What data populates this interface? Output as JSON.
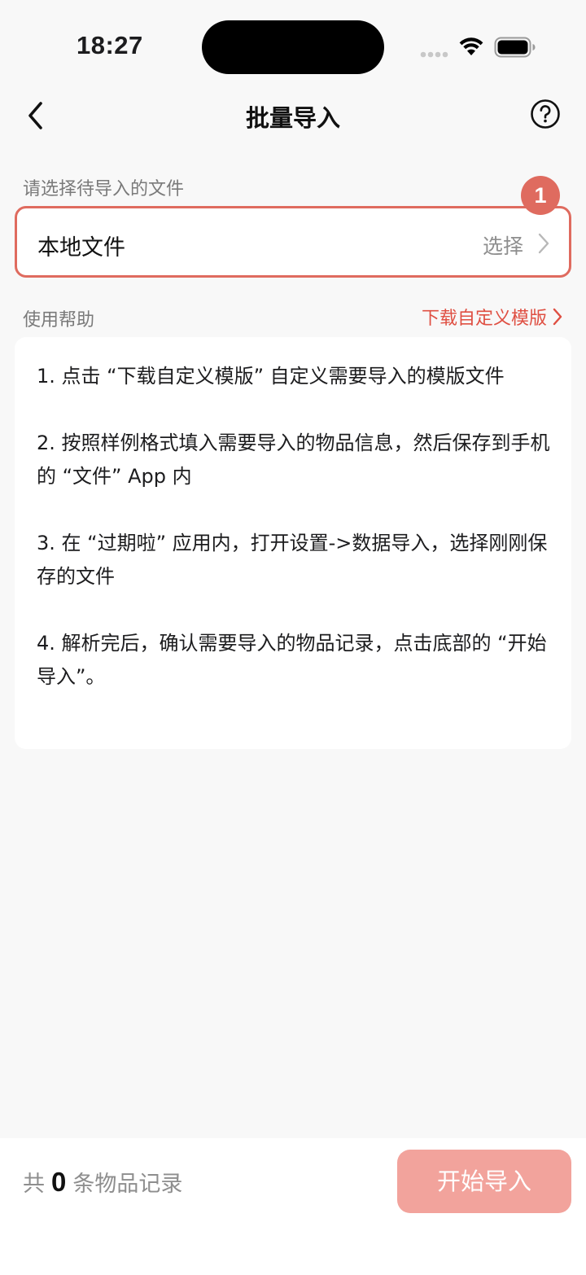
{
  "status_bar": {
    "time": "18:27"
  },
  "nav": {
    "title": "批量导入",
    "back_icon": "chevron-left-icon",
    "help_icon": "question-circle-icon"
  },
  "file_section": {
    "label": "请选择待导入的文件",
    "row_label": "本地文件",
    "row_action": "选择",
    "badge": "1"
  },
  "help_section": {
    "label": "使用帮助",
    "template_link": "下载自定义模版",
    "steps": [
      "1. 点击 “下载自定义模版” 自定义需要导入的模版文件",
      "2. 按照样例格式填入需要导入的物品信息，然后保存到手机的 “文件” App 内",
      "3. 在 “过期啦” 应用内，打开设置->数据导入，选择刚刚保存的文件",
      "4. 解析完后，确认需要导入的物品记录，点击底部的 “开始导入”。"
    ]
  },
  "bottom_bar": {
    "count_prefix": "共",
    "count": "0",
    "count_suffix": "条物品记录",
    "start_button": "开始导入"
  },
  "colors": {
    "accent": "#df6b5f",
    "link": "#df4f42",
    "button_disabled": "#f2a39c",
    "background": "#f8f8f8"
  }
}
